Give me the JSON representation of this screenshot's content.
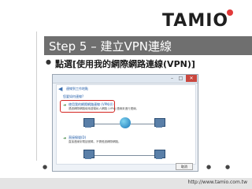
{
  "logo": {
    "text": "TAMIO"
  },
  "slide": {
    "title": "Step 5 – 建立VPN連線",
    "bullet": "點選[使用我的網際網路連線(VPN)]"
  },
  "dialog": {
    "title": "連線到工作地點",
    "question": "您要如何連線?",
    "options": [
      {
        "title": "使用我的網際網路連線 (VPN)(I)",
        "desc": "透過網際網路使用虛擬私人網路 (VPN) 連線來進行連線。"
      },
      {
        "title": "直接撥號(D)",
        "desc": "直接連線到電話號碼，不需經過網際網路。"
      }
    ],
    "cancel_label": "取消"
  },
  "footer": {
    "url": "http://www.tamio.com.tw"
  },
  "colors": {
    "title_bar": "#6f6f6f",
    "highlight": "#d2231f",
    "logo_dot": "#e23a3a"
  },
  "icons": [
    "back-arrow-icon",
    "computer-icon",
    "globe-icon",
    "window-close-icon"
  ]
}
